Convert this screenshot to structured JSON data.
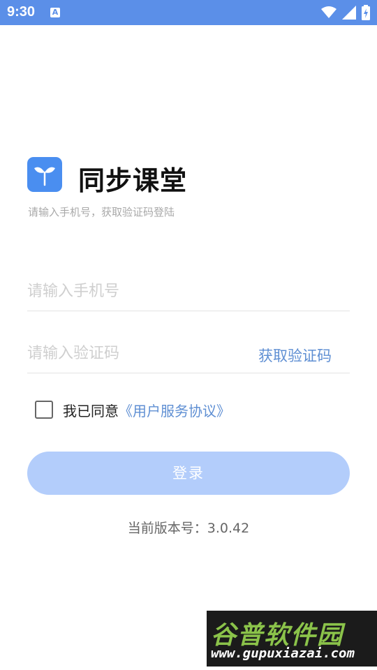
{
  "status_bar": {
    "time": "9:30",
    "notification_icon_letter": "A",
    "icons": [
      "wifi-icon",
      "signal-icon",
      "battery-charging-icon"
    ]
  },
  "app": {
    "name": "同步课堂",
    "logo_icon": "sprout-icon",
    "subtitle": "请输入手机号，获取验证码登陆"
  },
  "form": {
    "phone_placeholder": "请输入手机号",
    "code_placeholder": "请输入验证码",
    "get_code_label": "获取验证码",
    "agree_text": "我已同意",
    "agreement_link": "《用户服务协议》",
    "agree_checked": false,
    "login_label": "登录"
  },
  "version_text": "当前版本号：3.0.42",
  "watermark": {
    "title": "谷普软件园",
    "url": "www.gupuxiazai.com"
  },
  "colors": {
    "status_bar": "#5b8fe8",
    "logo": "#4a8ef0",
    "link": "#5f8fd3",
    "login_button_disabled": "#b3cdfb"
  }
}
